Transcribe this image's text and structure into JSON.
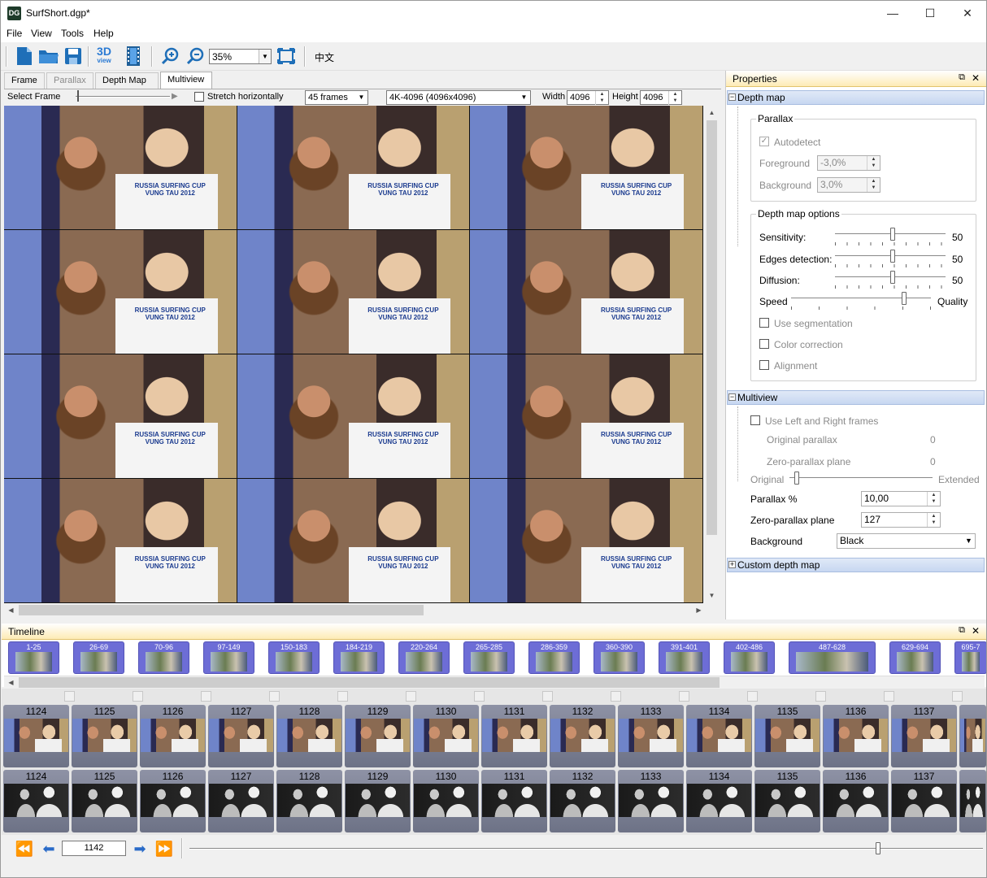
{
  "window": {
    "title": "SurfShort.dgp*",
    "app_icon": "DG",
    "minimize": "—",
    "maximize": "☐",
    "close": "✕"
  },
  "menu": [
    "File",
    "View",
    "Tools",
    "Help"
  ],
  "toolbar": {
    "zoom": "35%",
    "lang": "中文",
    "view3d": "3D"
  },
  "tabs": [
    "Frame",
    "Parallax",
    "Depth Map",
    "Multiview"
  ],
  "frame_bar": {
    "select_frame": "Select Frame",
    "stretch": "Stretch horizontally",
    "frames": "45 frames",
    "resolution": "4K-4096 (4096x4096)",
    "width_label": "Width",
    "width": "4096",
    "height_label": "Height",
    "height": "4096"
  },
  "viewer": {
    "shirt_text": "RUSSIA SURFING CUP VUNG TAU 2012"
  },
  "properties": {
    "title": "Properties",
    "depth_map": {
      "header": "Depth map",
      "parallax_group": "Parallax",
      "autodetect": "Autodetect",
      "foreground_label": "Foreground",
      "foreground": "-3,0%",
      "background_label": "Background",
      "background": "3,0%",
      "options_group": "Depth map options",
      "sensitivity_label": "Sensitivity:",
      "sensitivity": "50",
      "edges_label": "Edges detection:",
      "edges": "50",
      "diffusion_label": "Diffusion:",
      "diffusion": "50",
      "speed_label": "Speed",
      "quality_label": "Quality",
      "use_segmentation": "Use segmentation",
      "color_correction": "Color correction",
      "alignment": "Alignment"
    },
    "multiview": {
      "header": "Multiview",
      "use_lr": "Use Left and Right frames",
      "orig_parallax_label": "Original parallax",
      "orig_parallax": "0",
      "zero_plane_label": "Zero-parallax plane",
      "zero_plane": "0",
      "original_label": "Original",
      "extended_label": "Extended",
      "parallax_pct_label": "Parallax %",
      "parallax_pct": "10,00",
      "zp_label": "Zero-parallax plane",
      "zp": "127",
      "bg_label": "Background",
      "bg": "Black"
    },
    "custom": {
      "header": "Custom depth map"
    }
  },
  "timeline": {
    "title": "Timeline",
    "scenes": [
      "1-25",
      "26-69",
      "70-96",
      "97-149",
      "150-183",
      "184-219",
      "220-264",
      "265-285",
      "286-359",
      "360-390",
      "391-401",
      "402-486",
      "487-628",
      "629-694",
      "695-7"
    ],
    "frames": [
      "1124",
      "1125",
      "1126",
      "1127",
      "1128",
      "1129",
      "1130",
      "1131",
      "1132",
      "1133",
      "1134",
      "1135",
      "1136",
      "1137"
    ],
    "current_frame": "1142"
  },
  "colors": {
    "accent": "#6d6dd6",
    "panel_head": "#fdebb5",
    "section": "#c7d7f1"
  }
}
